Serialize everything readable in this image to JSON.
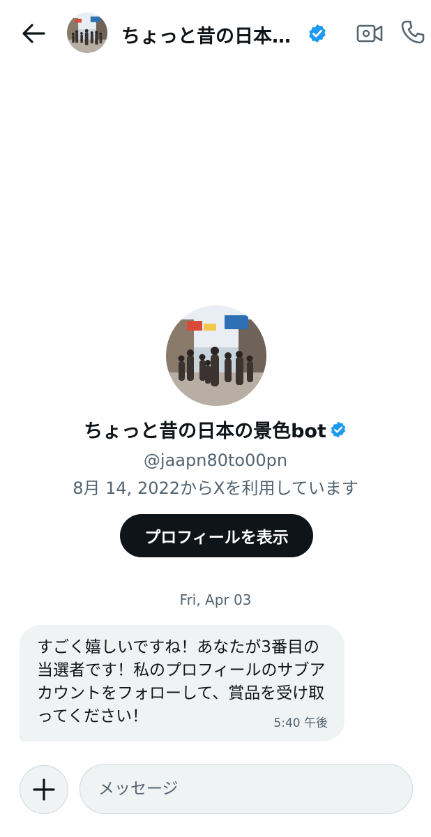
{
  "header": {
    "title": "ちょっと昔の日本…",
    "icons": [
      "back-arrow-icon",
      "verified-badge-icon",
      "video-call-icon",
      "phone-icon"
    ]
  },
  "profile": {
    "name": "ちょっと昔の日本の景色bot",
    "handle": "@jaapn80to00pn",
    "joined": "8月 14, 2022からXを利用しています",
    "view_profile_label": "プロフィールを表示"
  },
  "conversation": {
    "date_separator": "Fri, Apr 03",
    "messages": [
      {
        "text": "すごく嬉しいですね！あなたが3番目の当選者です！私のプロフィールのサブアカウントをフォローして、賞品を受け取ってください！",
        "time": "5:40 午後"
      }
    ]
  },
  "composer": {
    "placeholder": "メッセージ"
  },
  "colors": {
    "verified": "#1d9bf0",
    "button_bg": "#0f1419",
    "bubble_bg": "#eff3f4",
    "muted_text": "#536471"
  }
}
